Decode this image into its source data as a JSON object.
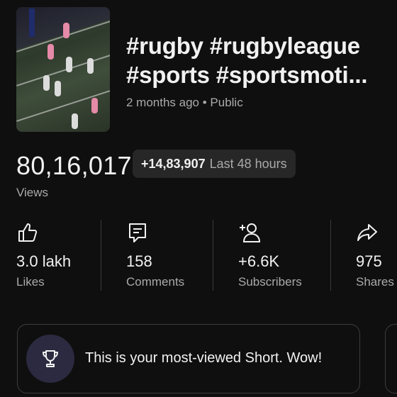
{
  "video": {
    "title_line1": "#rugby #rugbyleague",
    "title_line2": "#sports #sportsmoti...",
    "meta": "2 months ago • Public"
  },
  "views": {
    "count": "80,16,017",
    "label": "Views",
    "delta_value": "+14,83,907",
    "delta_label": "Last 48 hours"
  },
  "stats": [
    {
      "value": "3.0 lakh",
      "label": "Likes",
      "icon": "thumbs-up-icon"
    },
    {
      "value": "158",
      "label": "Comments",
      "icon": "comment-icon"
    },
    {
      "value": "+6.6K",
      "label": "Subscribers",
      "icon": "add-person-icon"
    },
    {
      "value": "975",
      "label": "Shares",
      "icon": "share-icon"
    }
  ],
  "highlight": {
    "message": "This is your most-viewed Short. Wow!",
    "icon": "trophy-icon",
    "accent": "#2b2a40"
  }
}
